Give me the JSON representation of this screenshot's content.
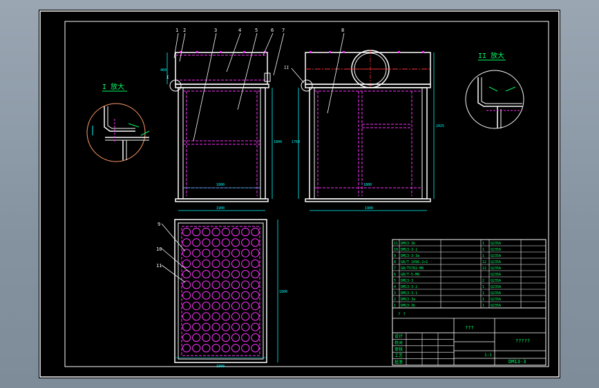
{
  "views": {
    "detail_i": {
      "title": "I 放大"
    },
    "detail_ii": {
      "title": "II 放大"
    },
    "front": {
      "dims": {
        "height_top": "460",
        "height_body": "1800",
        "width_inner": "1800",
        "width_overall": "1900"
      },
      "callout": "I",
      "part_labels": [
        "1",
        "2",
        "3",
        "4",
        "5",
        "6",
        "7"
      ]
    },
    "side": {
      "dims": {
        "height_left": "1760",
        "height_right": "2025",
        "width_inner": "1800",
        "width_overall": "1900"
      },
      "callout": "II",
      "part_labels": [
        "8"
      ]
    },
    "plan": {
      "dims": {
        "width": "1800",
        "height": "1800"
      },
      "part_labels": [
        "9",
        "10",
        "11"
      ]
    }
  },
  "parts_list": [
    {
      "no": "11",
      "code": "DM13-3b",
      "name": "",
      "qty": "1",
      "material": "Q235A",
      "note": ""
    },
    {
      "no": "10",
      "code": "DM13-3-1",
      "name": "",
      "qty": "1",
      "material": "Q235A",
      "note": ""
    },
    {
      "no": "9",
      "code": "DM13-3-3a",
      "name": "",
      "qty": "1",
      "material": "Q235A",
      "note": ""
    },
    {
      "no": "8",
      "code": "GB/T-1096-2×2",
      "name": "",
      "qty": "12",
      "material": "Q235A",
      "note": ""
    },
    {
      "no": "7",
      "code": "GB/T5782-M8",
      "name": "",
      "qty": "12",
      "material": "Q235A",
      "note": ""
    },
    {
      "no": "6",
      "code": "GB/T-5-M8",
      "name": "",
      "qty": "",
      "material": "Q235A",
      "note": ""
    },
    {
      "no": "5",
      "code": "DM13-3",
      "name": "",
      "qty": "2",
      "material": "Q235A",
      "note": ""
    },
    {
      "no": "4",
      "code": "DM13-3-2",
      "name": "",
      "qty": "1",
      "material": "Q235A",
      "note": ""
    },
    {
      "no": "3",
      "code": "DM13-3-1",
      "name": "",
      "qty": "1",
      "material": "Q235A",
      "note": ""
    },
    {
      "no": "2",
      "code": "DM13-3a",
      "name": "",
      "qty": "1",
      "material": "Q235A",
      "note": ""
    },
    {
      "no": "1",
      "code": "DM13-3b",
      "name": "",
      "qty": "1",
      "material": "Q235A",
      "note": ""
    }
  ],
  "title_block": {
    "drawing_name": "???",
    "drawing_no": "DM13-3",
    "company": "?????",
    "scale": "1:1",
    "row_labels": [
      "设计",
      "校对",
      "审核",
      "工艺",
      "批准"
    ],
    "placeholder": "? ?"
  },
  "colors": {
    "sheet": "#000000",
    "border": "#ffffff",
    "outline": "#ffffff",
    "hidden": "#ff33ff",
    "dimension": "#00ffff",
    "leader": "#ffffff",
    "centerline": "#ff3333",
    "text": "#00ff66",
    "pipe": "#ffff66"
  }
}
